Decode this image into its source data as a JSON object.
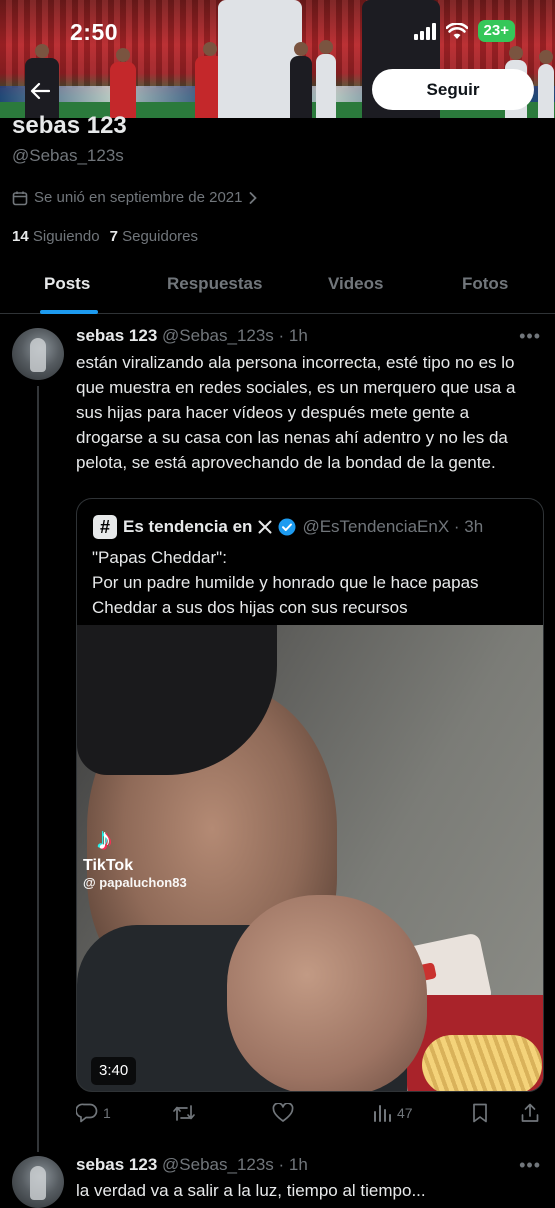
{
  "status_bar": {
    "time": "2:50",
    "battery": "23+"
  },
  "profile": {
    "follow_label": "Seguir",
    "name": "sebas 123",
    "handle": "@Sebas_123s",
    "joined": "Se unió en septiembre de 2021",
    "following_count": "14",
    "following_label": "Siguiendo",
    "followers_count": "7",
    "followers_label": "Seguidores"
  },
  "tabs": [
    "Posts",
    "Respuestas",
    "Videos",
    "Fotos"
  ],
  "active_tab": "Posts",
  "tweets": [
    {
      "name": "sebas 123",
      "handle_time": "@Sebas_123s · 1h",
      "text": "están viralizando ala persona incorrecta, esté tipo no es lo que muestra en redes sociales, es un merquero que usa a sus hijas para hacer vídeos y después mete gente a drogarse a su casa con las nenas ahí adentro y no les da pelota, se está aprovechando de la bondad de la gente.",
      "quote": {
        "name": "Es tendencia en",
        "handle_time": "@EsTendenciaEnX · 3h",
        "text_line1": "\"Papas Cheddar\":",
        "text_line2": "Por un padre humilde y honrado que le hace papas Cheddar a sus dos hijas con sus recursos",
        "video_duration": "3:40",
        "tiktok_label": "TikTok",
        "tiktok_user": "@ papaluchon83"
      },
      "actions": {
        "replies": "1",
        "retweets": "",
        "likes": "",
        "views": "47"
      }
    },
    {
      "name": "sebas 123",
      "handle_time": "@Sebas_123s · 1h",
      "text": "la verdad va a salir a la luz, tiempo al tiempo..."
    }
  ],
  "colors": {
    "accent": "#1d9bf0",
    "background": "#000000",
    "text": "#e7e9ea",
    "secondary": "#71767b",
    "verified": "#1d9bf0",
    "battery": "#35c759"
  }
}
